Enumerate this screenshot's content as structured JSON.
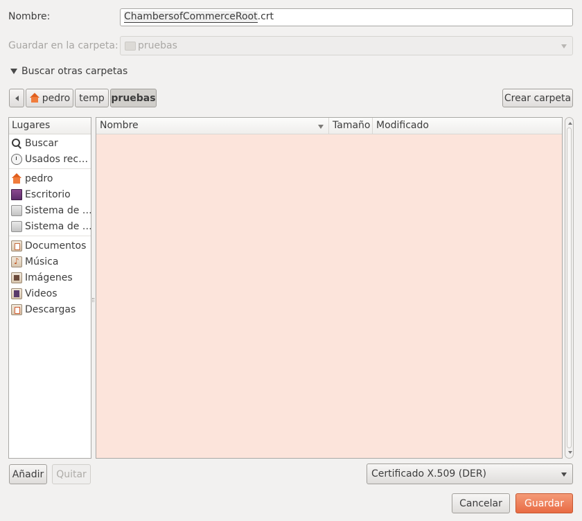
{
  "name_row": {
    "label": "Nombre:",
    "filename_selected": "ChambersofCommerceRoot",
    "filename_ext": ".crt"
  },
  "folder_row": {
    "label": "Guardar en la carpeta:",
    "value": "pruebas"
  },
  "expander": {
    "label": "Buscar otras carpetas"
  },
  "path_bar": {
    "items": [
      "pedro",
      "temp",
      "pruebas"
    ],
    "create_folder": "Crear carpeta"
  },
  "places": {
    "header": "Lugares",
    "items": [
      {
        "label": "Buscar",
        "icon": "search-icon"
      },
      {
        "label": "Usados rec…",
        "icon": "recent-icon"
      },
      {
        "label": "pedro",
        "icon": "home-icon"
      },
      {
        "label": "Escritorio",
        "icon": "desktop-icon"
      },
      {
        "label": "Sistema de …",
        "icon": "drive-icon"
      },
      {
        "label": "Sistema de …",
        "icon": "drive-icon"
      },
      {
        "label": "Documentos",
        "icon": "documents-folder-icon"
      },
      {
        "label": "Música",
        "icon": "music-folder-icon"
      },
      {
        "label": "Imágenes",
        "icon": "pictures-folder-icon"
      },
      {
        "label": "Videos",
        "icon": "videos-folder-icon"
      },
      {
        "label": "Descargas",
        "icon": "downloads-folder-icon"
      }
    ],
    "add": "Añadir",
    "remove": "Quitar"
  },
  "file_list": {
    "columns": [
      "Nombre",
      "Tamaño",
      "Modificado"
    ],
    "bg_color": "#fce4db"
  },
  "filter": {
    "value": "Certificado X.509 (DER)"
  },
  "actions": {
    "cancel": "Cancelar",
    "save": "Guardar",
    "accent": "#e86b44"
  }
}
